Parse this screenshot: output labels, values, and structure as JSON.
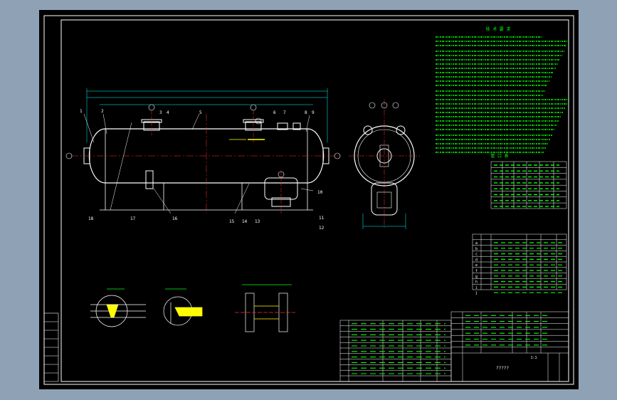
{
  "colors": {
    "background": "#000000",
    "frame": "#ffffff",
    "geometry": "#ffffff",
    "centerline": "#ff3030",
    "notes": "#00ff00",
    "dimension": "#00ffff",
    "hatch": "#ffff00"
  },
  "notes_title": "技 术 要 求",
  "nozzle_table_title": "管 口 表",
  "part_numbers": [
    "1",
    "2",
    "3",
    "4",
    "5",
    "6",
    "7",
    "8",
    "9",
    "10",
    "11",
    "12",
    "13",
    "14",
    "15",
    "16",
    "17",
    "18"
  ],
  "nozzle_marks": [
    "a",
    "b",
    "c",
    "d",
    "e",
    "f",
    "g",
    "h",
    "i",
    "j"
  ],
  "parts_list_header": [
    "件号",
    "图号或标准号",
    "名称",
    "数量",
    "材料",
    "重量"
  ],
  "drawing_title": "?????",
  "scale_text": "1:1"
}
